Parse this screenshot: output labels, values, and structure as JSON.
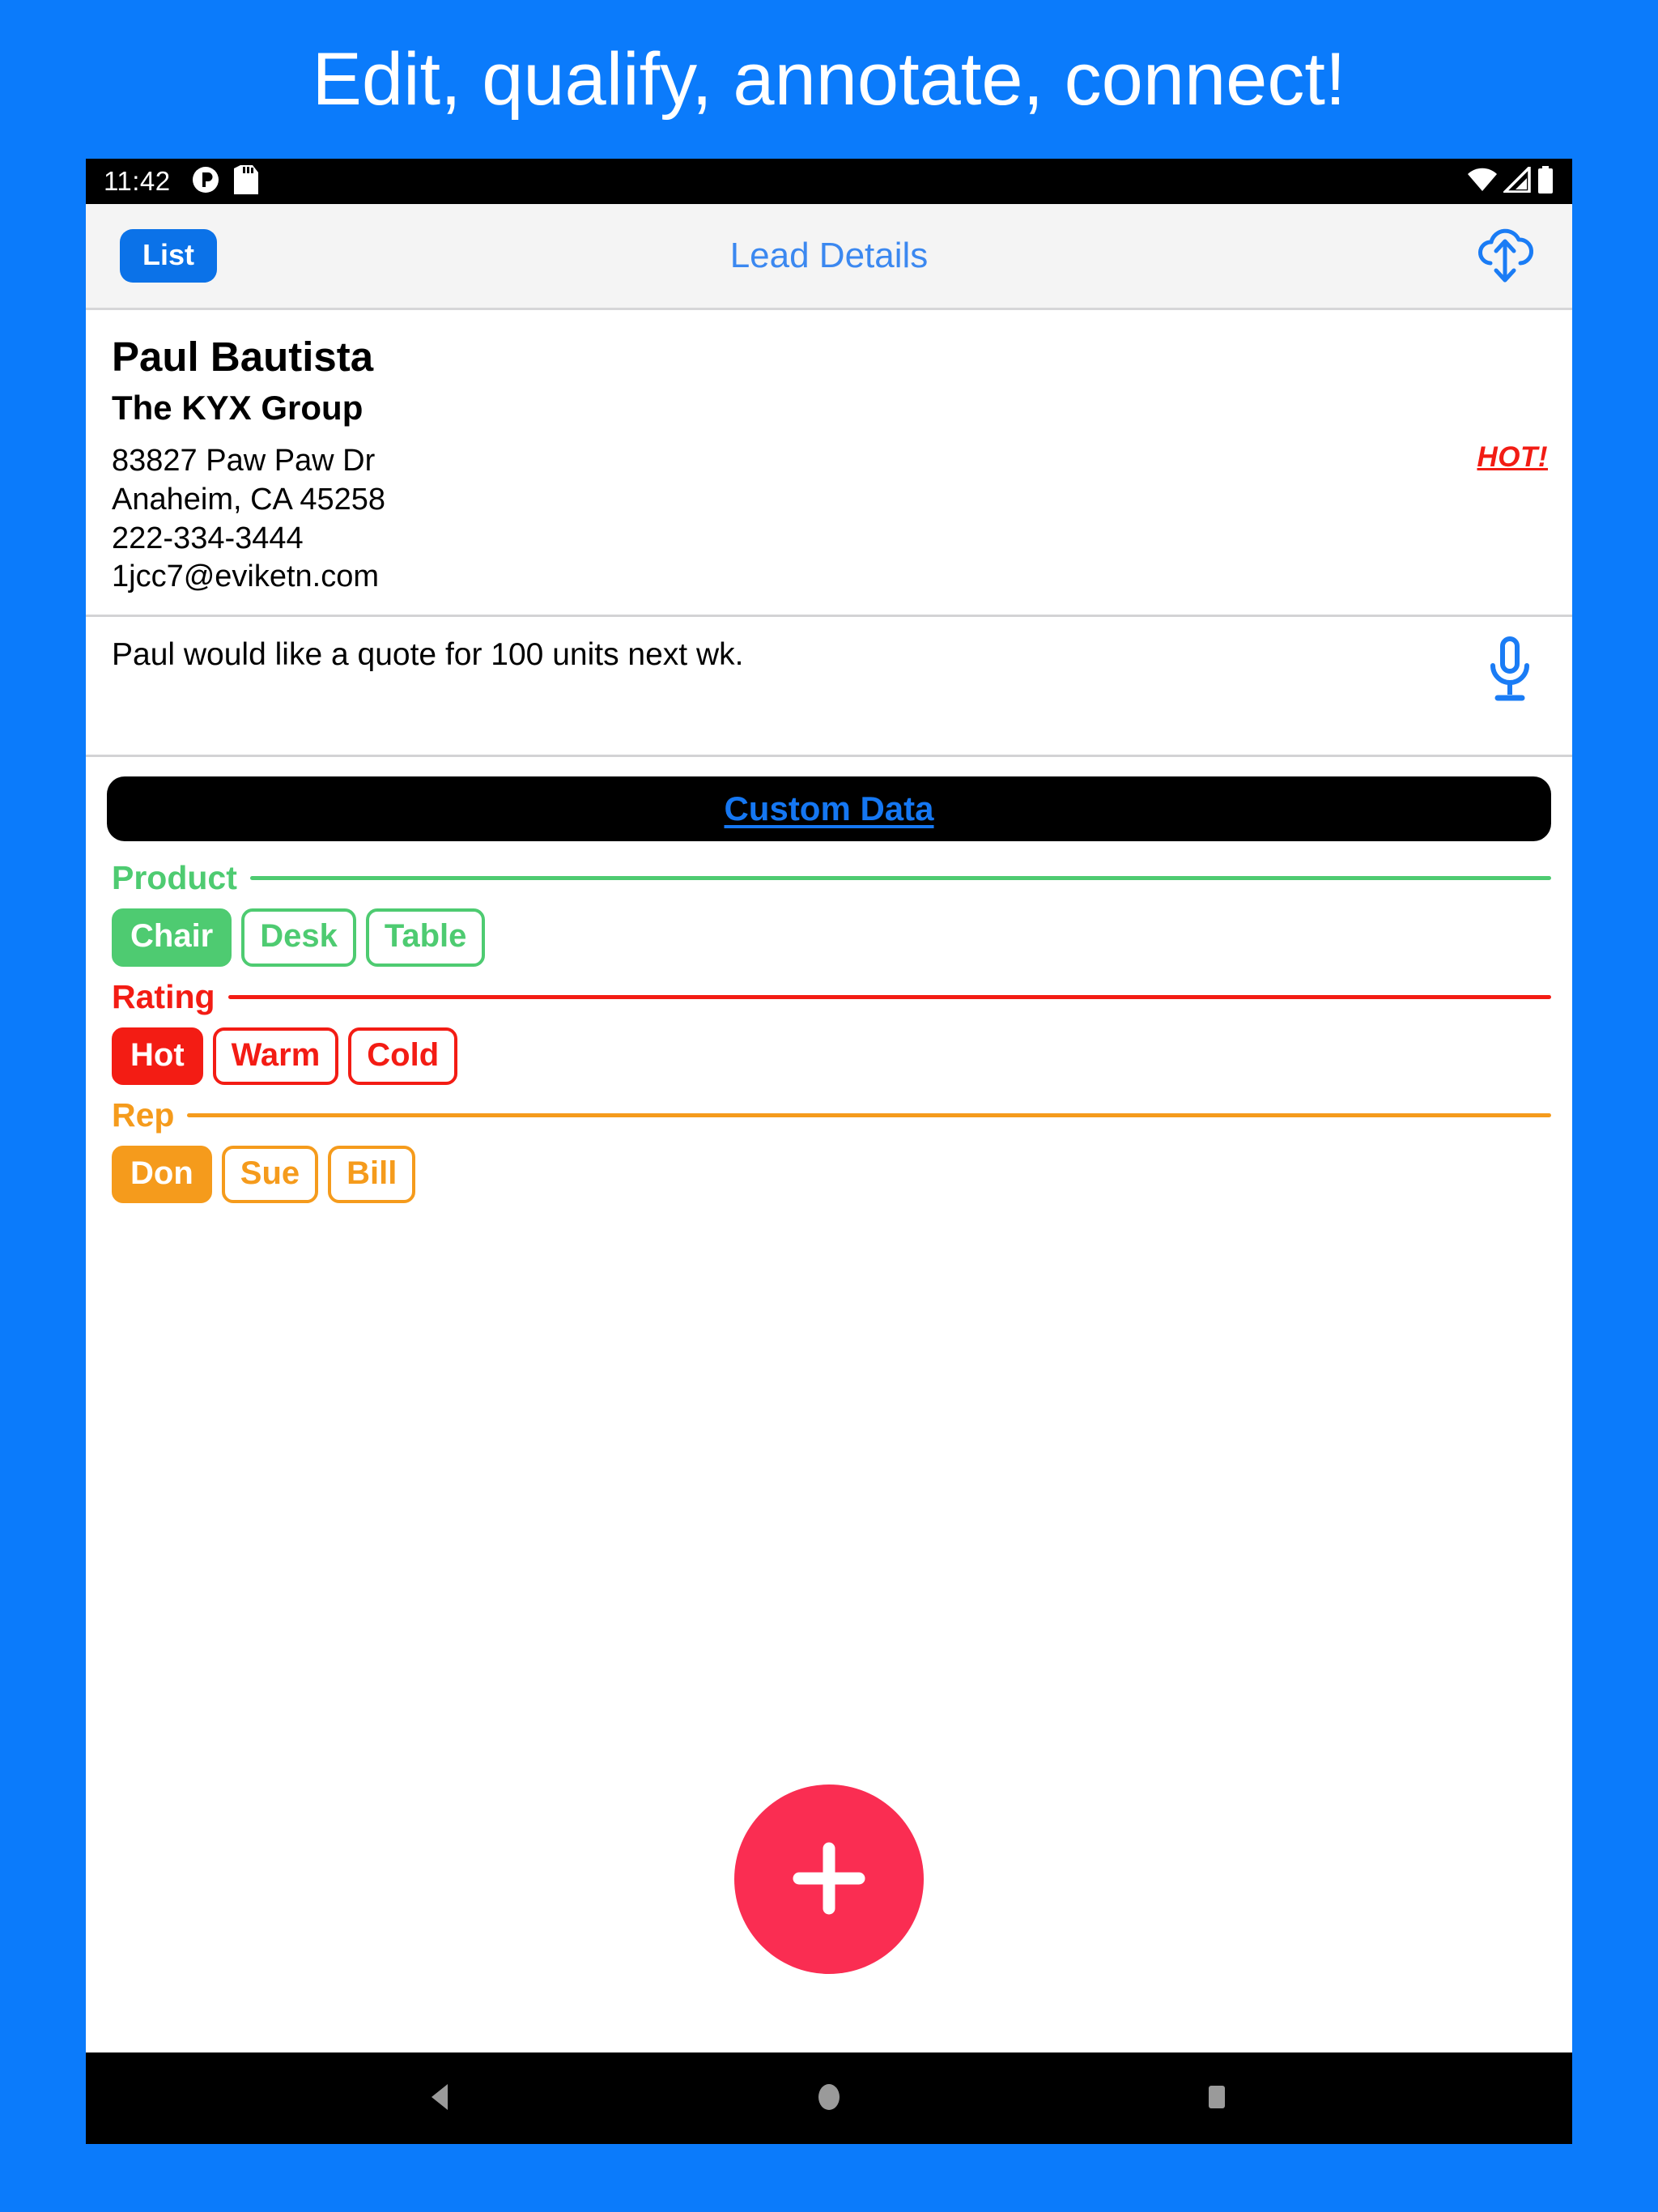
{
  "promo": {
    "headline": "Edit, qualify, annotate, connect!",
    "background_color": "#0B7BFB",
    "text_color": "#FFFFFF"
  },
  "status_bar": {
    "time": "11:42",
    "left_icons": [
      "app-notification-icon",
      "sd-card-icon"
    ],
    "right_icons": [
      "wifi-icon",
      "cellular-signal-icon",
      "battery-icon"
    ]
  },
  "app_bar": {
    "back_label": "List",
    "title": "Lead Details",
    "sync_icon": "cloud-sync-icon",
    "title_color": "#3B88F0",
    "button_color": "#0B72E8"
  },
  "lead": {
    "name": "Paul Bautista",
    "company": "The KYX Group",
    "address_line1": "83827 Paw Paw Dr",
    "address_line2": "Anaheim, CA 45258",
    "phone": "222-334-3444",
    "email": "1jcc7@eviketn.com",
    "status_badge": "HOT!",
    "status_badge_color": "#F21C14"
  },
  "note": {
    "text": "Paul would like a quote for 100 units next wk.",
    "mic_icon": "microphone-icon"
  },
  "custom_data": {
    "header_label": "Custom Data",
    "header_text_color": "#1577F2",
    "header_bg_color": "#000000",
    "groups": [
      {
        "title": "Product",
        "color": "#4ECB71",
        "options": [
          {
            "label": "Chair",
            "selected": true
          },
          {
            "label": "Desk",
            "selected": false
          },
          {
            "label": "Table",
            "selected": false
          }
        ]
      },
      {
        "title": "Rating",
        "color": "#F31C14",
        "options": [
          {
            "label": "Hot",
            "selected": true
          },
          {
            "label": "Warm",
            "selected": false
          },
          {
            "label": "Cold",
            "selected": false
          }
        ]
      },
      {
        "title": "Rep",
        "color": "#F59B1C",
        "options": [
          {
            "label": "Don",
            "selected": true
          },
          {
            "label": "Sue",
            "selected": false
          },
          {
            "label": "Bill",
            "selected": false
          }
        ]
      }
    ]
  },
  "fab": {
    "icon": "plus-icon",
    "color": "#FA2D52"
  },
  "nav_bar": {
    "buttons": [
      "back-icon",
      "home-icon",
      "recents-icon"
    ],
    "icon_color": "#9A9A9A"
  }
}
